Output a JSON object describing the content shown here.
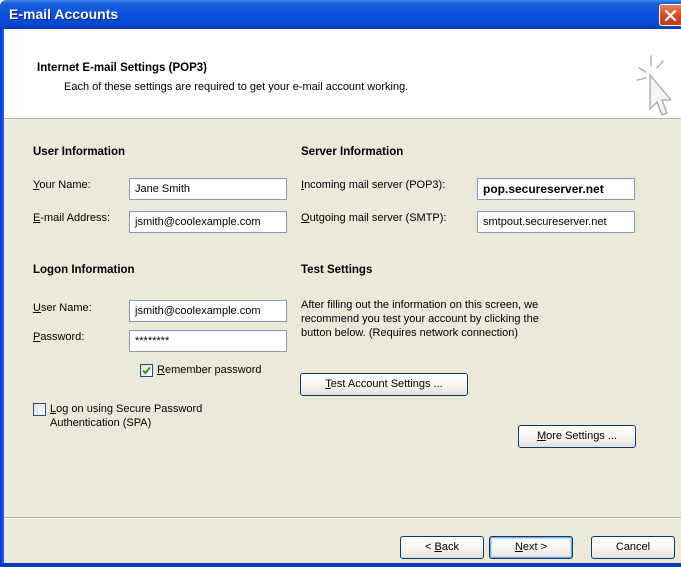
{
  "window": {
    "title": "E-mail Accounts"
  },
  "header": {
    "title": "Internet E-mail Settings (POP3)",
    "subtitle": "Each of these settings are required to get your e-mail account working."
  },
  "user_info": {
    "section": "User Information",
    "your_name_label_key": "Y",
    "your_name_label_rest": "our Name:",
    "your_name_value": "Jane Smith",
    "email_label_key": "E",
    "email_label_rest": "-mail Address:",
    "email_value": "jsmith@coolexample.com"
  },
  "server_info": {
    "section": "Server Information",
    "incoming_label_key": "I",
    "incoming_label_rest": "ncoming mail server (POP3):",
    "incoming_value": "pop.secureserver.net",
    "outgoing_label_key": "O",
    "outgoing_label_rest": "utgoing mail server (SMTP):",
    "outgoing_value": "smtpout.secureserver.net"
  },
  "logon_info": {
    "section": "Logon Information",
    "username_label_key": "U",
    "username_label_rest": "ser Name:",
    "username_value": "jsmith@coolexample.com",
    "password_label_key": "P",
    "password_label_rest": "assword:",
    "password_value": "********",
    "remember_key": "R",
    "remember_rest": "emember password",
    "remember_checked": true,
    "spa_key": "L",
    "spa_rest_line1": "og on using Secure Password",
    "spa_line2": "Authentication (SPA)",
    "spa_checked": false
  },
  "test_settings": {
    "section": "Test Settings",
    "line1": "After filling out the information on this screen, we",
    "line2": "recommend you test your account by clicking the",
    "line3": "button below. (Requires network connection)",
    "test_key": "T",
    "test_rest": "est Account Settings ...",
    "more_key": "M",
    "more_rest": "ore Settings ..."
  },
  "footer": {
    "back_prefix": "< ",
    "back_key": "B",
    "back_rest": "ack",
    "next_key": "N",
    "next_rest": "ext >",
    "cancel": "Cancel"
  },
  "colors": {
    "titlebar": "#0a51e2",
    "dialog_bg": "#ece9d8",
    "field_border": "#7f9db9",
    "check_green": "#21a121"
  },
  "icons": {
    "close": "close-icon",
    "wizard": "cursor-sparkle-icon",
    "check": "check-icon"
  }
}
